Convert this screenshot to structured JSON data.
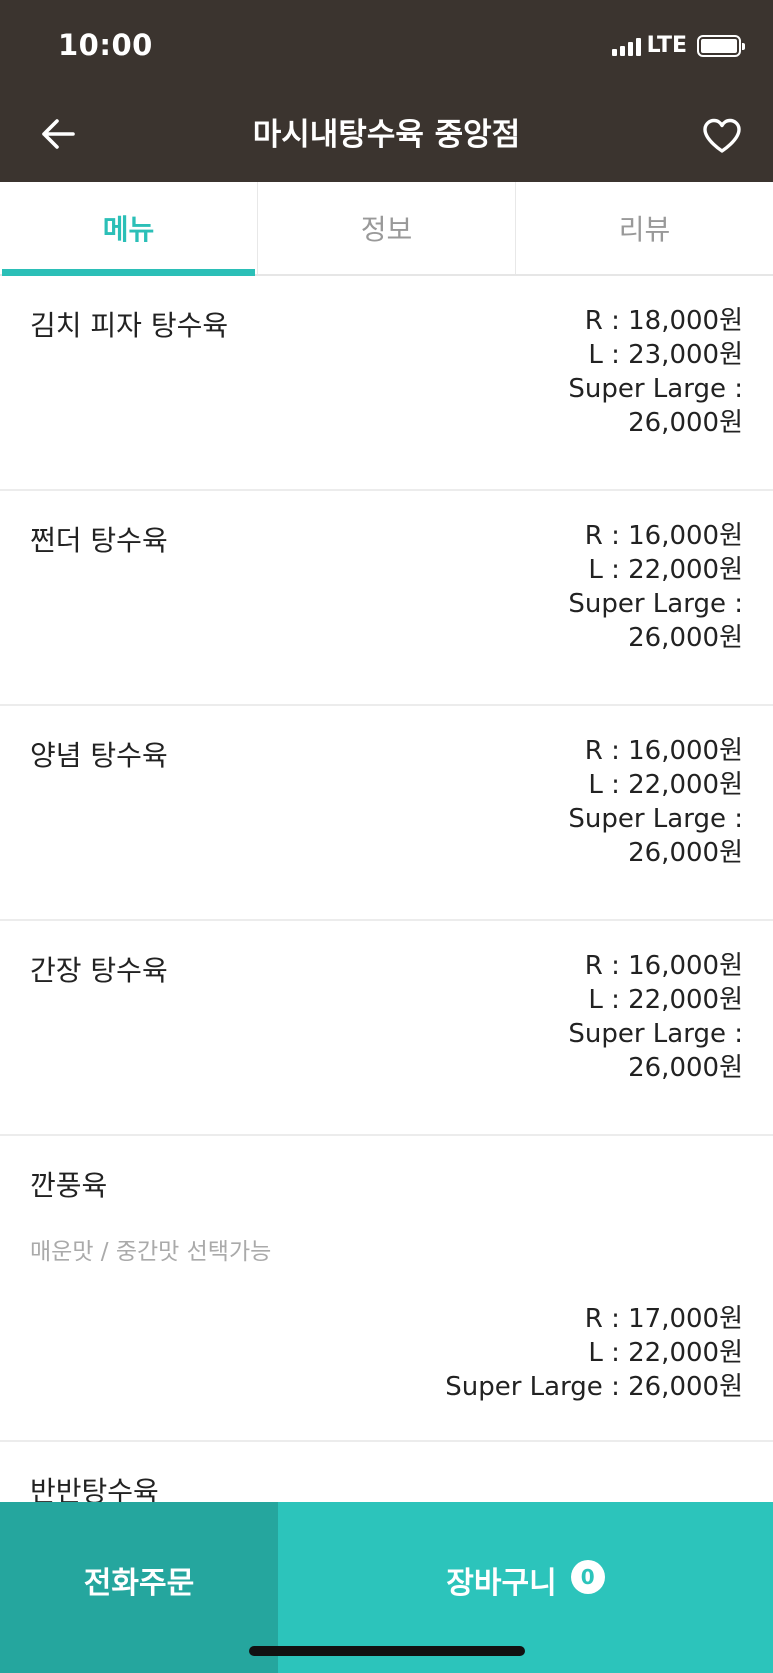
{
  "status": {
    "time": "10:00",
    "network": "LTE"
  },
  "header": {
    "title": "마시내탕수육 중앙점",
    "back_icon": "arrow-left-icon",
    "favorite_icon": "heart-outline-icon"
  },
  "tabs": [
    {
      "label": "메뉴",
      "active": true
    },
    {
      "label": "정보",
      "active": false
    },
    {
      "label": "리뷰",
      "active": false
    }
  ],
  "menu": [
    {
      "name": "김치 피자 탕수육",
      "prices": [
        "R : 18,000원",
        "L : 23,000원",
        "Super Large :",
        "26,000원"
      ]
    },
    {
      "name": "쩐더 탕수육",
      "prices": [
        "R : 16,000원",
        "L : 22,000원",
        "Super Large :",
        "26,000원"
      ]
    },
    {
      "name": "양념 탕수육",
      "prices": [
        "R : 16,000원",
        "L : 22,000원",
        "Super Large :",
        "26,000원"
      ]
    },
    {
      "name": "간장 탕수육",
      "prices": [
        "R : 16,000원",
        "L : 22,000원",
        "Super Large :",
        "26,000원"
      ]
    },
    {
      "name": "깐풍육",
      "description": "매운맛 / 중간맛 선택가능",
      "prices": [
        "R : 17,000원",
        "L : 22,000원",
        "Super Large : 26,000원"
      ]
    },
    {
      "name": "반반탕수육"
    }
  ],
  "bottom": {
    "phone_order": "전화주문",
    "cart": "장바구니",
    "cart_count": "0"
  },
  "colors": {
    "header_bg": "#3b342f",
    "accent": "#2bbfb7",
    "phone_btn": "#25a69e",
    "cart_btn": "#2cc4bb"
  }
}
